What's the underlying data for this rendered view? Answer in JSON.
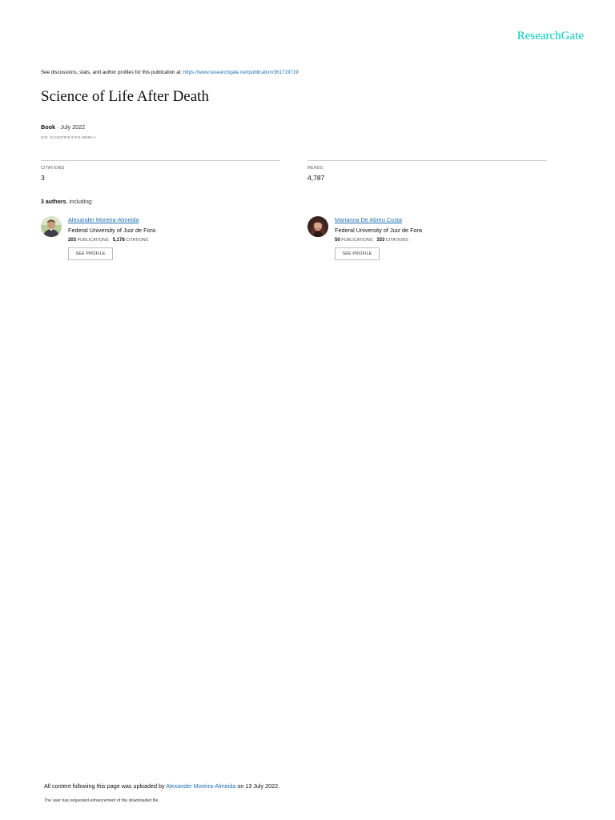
{
  "brand": "ResearchGate",
  "discuss": {
    "prefix": "See discussions, stats, and author profiles for this publication at: ",
    "link": "https://www.researchgate.net/publication/361719719"
  },
  "title": "Science of Life After Death",
  "pub": {
    "type": "Book",
    "date": " · July 2022",
    "doi": "DOI: 10.1007/978-3-031-06056-4"
  },
  "stats": {
    "citations_label": "CITATIONS",
    "citations_value": "3",
    "reads_label": "READS",
    "reads_value": "4,787"
  },
  "authors_heading": {
    "count": "3 authors",
    "suffix": ", including:"
  },
  "authors": [
    {
      "name": "Alexander Moreira-Almeida",
      "institution": "Federal University of Juiz de Fora",
      "publications": "203",
      "publications_label": "PUBLICATIONS",
      "citations": "5,178",
      "citations_label": "CITATIONS",
      "button": "SEE PROFILE"
    },
    {
      "name": "Marianna De Abreu Costa",
      "institution": "Federal University of Juiz de Fora",
      "publications": "50",
      "publications_label": "PUBLICATIONS",
      "citations": "333",
      "citations_label": "CITATIONS",
      "button": "SEE PROFILE"
    }
  ],
  "footer": {
    "uploaded_prefix": "All content following this page was uploaded by ",
    "uploaded_by": "Alexander Moreira-Almeida",
    "uploaded_suffix": " on 13 July 2022.",
    "enhancement": "The user has requested enhancement of the downloaded file."
  },
  "colors": {
    "brand": "#00ccbb",
    "link": "#1f6fb2"
  }
}
